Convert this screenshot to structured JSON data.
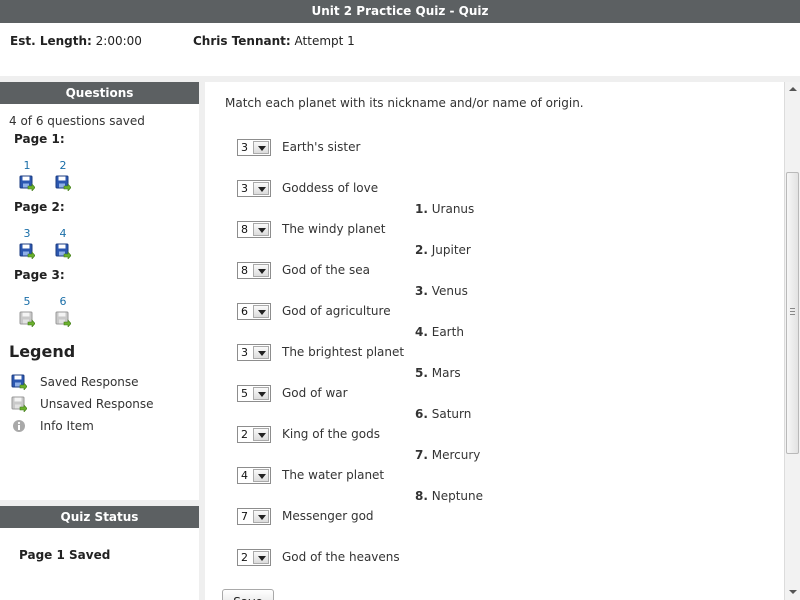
{
  "window": {
    "title": "Unit 2 Practice Quiz - Quiz"
  },
  "info": {
    "length_label": "Est. Length:",
    "length_value": "2:00:00",
    "user_name": "Chris Tennant:",
    "attempt": "Attempt 1"
  },
  "questions_panel": {
    "title": "Questions",
    "saved_count": "4 of 6 questions saved",
    "pages": [
      {
        "label": "Page 1:",
        "questions": [
          {
            "num": "1",
            "saved": true
          },
          {
            "num": "2",
            "saved": true
          }
        ]
      },
      {
        "label": "Page 2:",
        "questions": [
          {
            "num": "3",
            "saved": true
          },
          {
            "num": "4",
            "saved": true
          }
        ]
      },
      {
        "label": "Page 3:",
        "questions": [
          {
            "num": "5",
            "saved": false
          },
          {
            "num": "6",
            "saved": false
          }
        ]
      }
    ]
  },
  "legend": {
    "title": "Legend",
    "items": [
      {
        "icon": "saved-disk-icon",
        "label": "Saved Response"
      },
      {
        "icon": "unsaved-disk-icon",
        "label": "Unsaved Response"
      },
      {
        "icon": "info-icon",
        "label": "Info Item"
      }
    ]
  },
  "status_panel": {
    "title": "Quiz Status",
    "message": "Page 1 Saved"
  },
  "quiz": {
    "instructions": "Match each planet with its nickname and/or name of origin.",
    "items": [
      {
        "value": "3",
        "text": "Earth's sister"
      },
      {
        "value": "3",
        "text": "Goddess of love"
      },
      {
        "value": "8",
        "text": "The windy planet"
      },
      {
        "value": "8",
        "text": "God of the sea"
      },
      {
        "value": "6",
        "text": "God of agriculture"
      },
      {
        "value": "3",
        "text": "The brightest planet"
      },
      {
        "value": "5",
        "text": "God of war"
      },
      {
        "value": "2",
        "text": "King of the gods"
      },
      {
        "value": "4",
        "text": "The water planet"
      },
      {
        "value": "7",
        "text": "Messenger god"
      },
      {
        "value": "2",
        "text": "God of the heavens"
      }
    ],
    "answers": [
      {
        "num": "1.",
        "name": "Uranus"
      },
      {
        "num": "2.",
        "name": "Jupiter"
      },
      {
        "num": "3.",
        "name": "Venus"
      },
      {
        "num": "4.",
        "name": "Earth"
      },
      {
        "num": "5.",
        "name": "Mars"
      },
      {
        "num": "6.",
        "name": "Saturn"
      },
      {
        "num": "7.",
        "name": "Mercury"
      },
      {
        "num": "8.",
        "name": "Neptune"
      }
    ],
    "save_label": "Save"
  },
  "colors": {
    "header_bg": "#5c6062",
    "link_blue": "#1a6ea8",
    "disk_blue": "#2b57b0",
    "arrow_green": "#6bb12e"
  }
}
